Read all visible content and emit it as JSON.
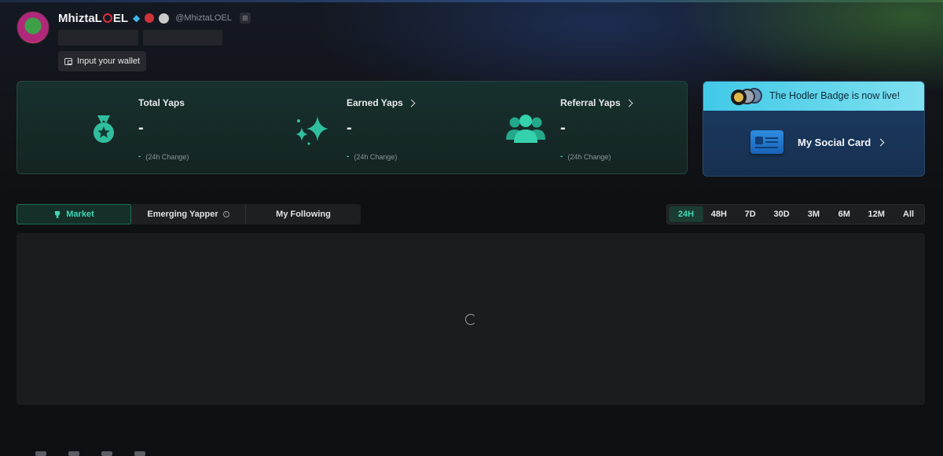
{
  "profile": {
    "name_prefix": "MhiztaL",
    "name_suffix": "EL",
    "handle": "@MhiztaLOEL",
    "wallet_button": "Input your wallet"
  },
  "stats": [
    {
      "title": "Total Yaps",
      "value": "-",
      "change": "-",
      "change_label": "(24h Change)",
      "icon": "medal-star-icon"
    },
    {
      "title": "Earned Yaps",
      "value": "-",
      "change": "-",
      "change_label": "(24h Change)",
      "icon": "sparkles-icon"
    },
    {
      "title": "Referral Yaps",
      "value": "-",
      "change": "-",
      "change_label": "(24h Change)",
      "icon": "users-icon"
    }
  ],
  "card": {
    "banner": "The Hodler Badge is now live!",
    "social_label": "My Social Card"
  },
  "tabs": [
    {
      "label": "Market",
      "active": true
    },
    {
      "label": "Emerging Yapper",
      "active": false
    },
    {
      "label": "My Following",
      "active": false
    }
  ],
  "ranges": [
    "24H",
    "48H",
    "7D",
    "30D",
    "3M",
    "6M",
    "12M",
    "All"
  ],
  "active_range": "24H",
  "colors": {
    "accent": "#3fd7b5",
    "stats_bg": "#17312e",
    "banner": "#41c9e7",
    "card_bg": "#1c3c66"
  }
}
